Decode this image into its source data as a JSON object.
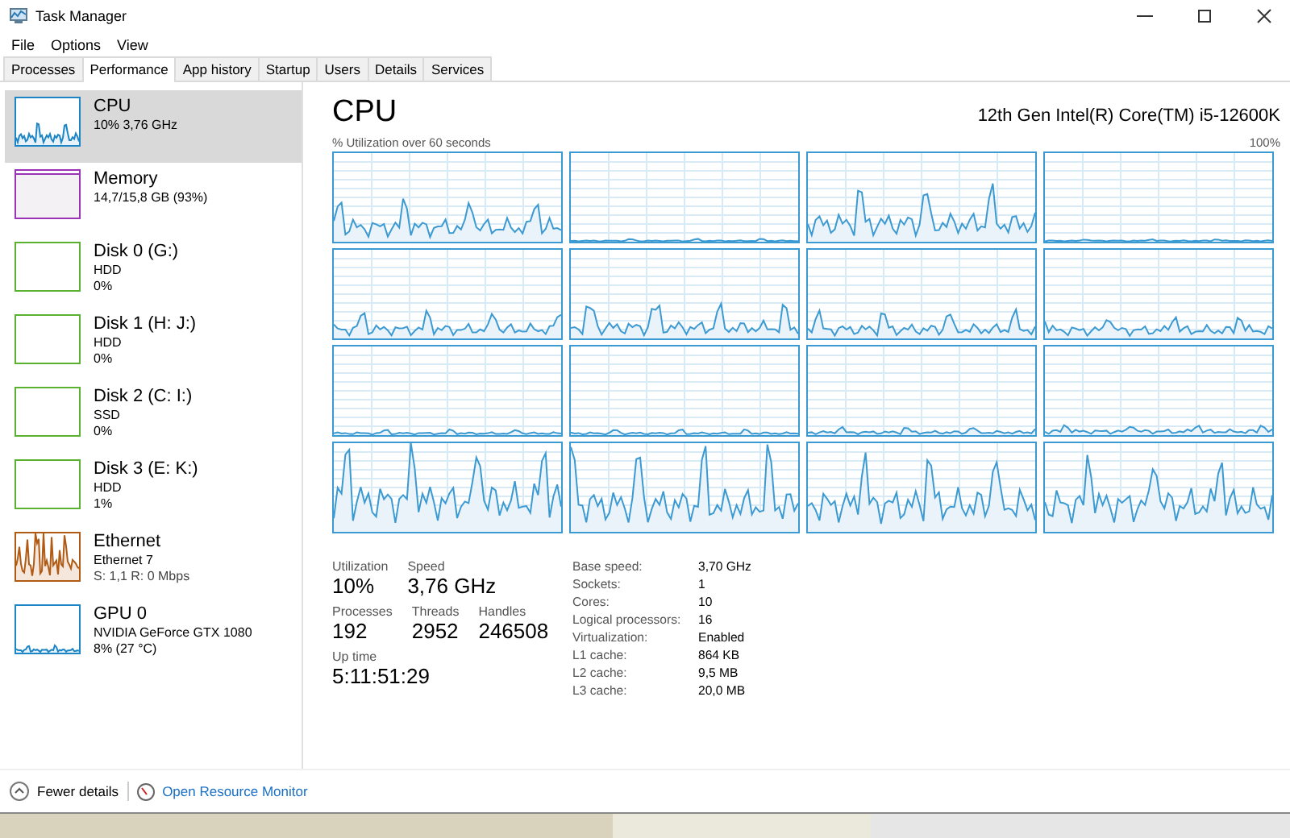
{
  "window": {
    "title": "Task Manager"
  },
  "menu": [
    "File",
    "Options",
    "View"
  ],
  "tabs": [
    {
      "label": "Processes",
      "selected": false
    },
    {
      "label": "Performance",
      "selected": true
    },
    {
      "label": "App history",
      "selected": false
    },
    {
      "label": "Startup",
      "selected": false
    },
    {
      "label": "Users",
      "selected": false
    },
    {
      "label": "Details",
      "selected": false
    },
    {
      "label": "Services",
      "selected": false
    }
  ],
  "sidebar": {
    "items": [
      {
        "kind": "cpu",
        "name": "CPU",
        "lines": [
          "10%  3,76 GHz"
        ],
        "color": "#1b85c6",
        "selected": true
      },
      {
        "kind": "memory",
        "name": "Memory",
        "lines": [
          "14,7/15,8 GB (93%)"
        ],
        "color": "#9a33b6",
        "selected": false
      },
      {
        "kind": "disk",
        "name": "Disk 0 (G:)",
        "lines": [
          "HDD",
          "0%"
        ],
        "color": "#5ab130",
        "selected": false
      },
      {
        "kind": "disk",
        "name": "Disk 1 (H: J:)",
        "lines": [
          "HDD",
          "0%"
        ],
        "color": "#5ab130",
        "selected": false
      },
      {
        "kind": "disk",
        "name": "Disk 2 (C: I:)",
        "lines": [
          "SSD",
          "0%"
        ],
        "color": "#5ab130",
        "selected": false
      },
      {
        "kind": "disk",
        "name": "Disk 3 (E: K:)",
        "lines": [
          "HDD",
          "1%"
        ],
        "color": "#5ab130",
        "selected": false
      },
      {
        "kind": "network",
        "name": "Ethernet",
        "lines": [
          "Ethernet 7",
          "S: 1,1  R: 0 Mbps"
        ],
        "color": "#b15a13",
        "selected": false
      },
      {
        "kind": "gpu",
        "name": "GPU 0",
        "lines": [
          "NVIDIA GeForce GTX 1080",
          "8%  (27 °C)"
        ],
        "color": "#1b85c6",
        "selected": false
      }
    ]
  },
  "main": {
    "title": "CPU",
    "model": "12th Gen Intel(R) Core(TM) i5-12600K",
    "graph_caption": "% Utilization over 60 seconds",
    "graph_max": "100%"
  },
  "stats": [
    [
      {
        "label": "Utilization",
        "value": "10%"
      },
      {
        "label": "Speed",
        "value": "3,76 GHz"
      }
    ],
    [
      {
        "label": "Processes",
        "value": "192"
      },
      {
        "label": "Threads",
        "value": "2952"
      },
      {
        "label": "Handles",
        "value": "246508"
      }
    ],
    [
      {
        "label": "Up time",
        "value": "5:11:51:29"
      }
    ]
  ],
  "details": [
    {
      "label": "Base speed:",
      "value": "3,70 GHz"
    },
    {
      "label": "Sockets:",
      "value": "1"
    },
    {
      "label": "Cores:",
      "value": "10"
    },
    {
      "label": "Logical processors:",
      "value": "16"
    },
    {
      "label": "Virtualization:",
      "value": "Enabled"
    },
    {
      "label": "L1 cache:",
      "value": "864 KB"
    },
    {
      "label": "L2 cache:",
      "value": "9,5 MB"
    },
    {
      "label": "L3 cache:",
      "value": "20,0 MB"
    }
  ],
  "footer": {
    "fewer": "Fewer details",
    "link": "Open Resource Monitor"
  }
}
